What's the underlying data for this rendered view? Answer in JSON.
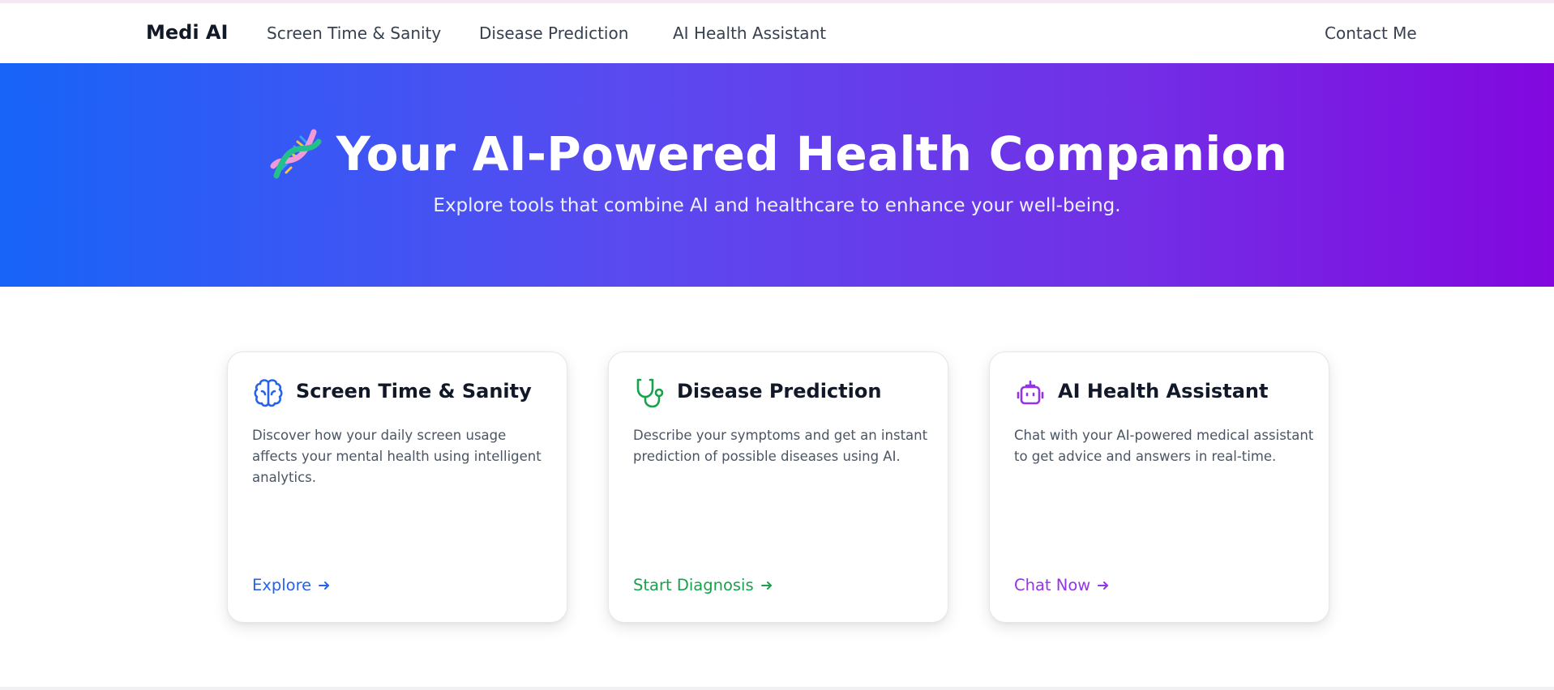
{
  "nav": {
    "brand": "Medi AI",
    "links": [
      "Screen Time & Sanity",
      "Disease Prediction",
      "AI Health Assistant"
    ],
    "contact": "Contact Me"
  },
  "hero": {
    "icon": "dna-icon",
    "title": "Your AI-Powered Health Companion",
    "subtitle": "Explore tools that combine AI and healthcare to enhance your well-being.",
    "gradient": [
      "#1764f8",
      "#8208df"
    ]
  },
  "cards": [
    {
      "icon": "brain-icon",
      "title": "Screen Time & Sanity",
      "description": "Discover how your daily screen usage affects your mental health using intelligent analytics.",
      "link_label": "Explore",
      "color": "#2563eb"
    },
    {
      "icon": "stethoscope-icon",
      "title": "Disease Prediction",
      "description": "Describe your symptoms and get an instant prediction of possible diseases using AI.",
      "link_label": "Start Diagnosis",
      "color": "#16a34a"
    },
    {
      "icon": "robot-icon",
      "title": "AI Health Assistant",
      "description": "Chat with your AI-powered medical assistant to get advice and answers in real-time.",
      "link_label": "Chat Now",
      "color": "#9333ea"
    }
  ]
}
